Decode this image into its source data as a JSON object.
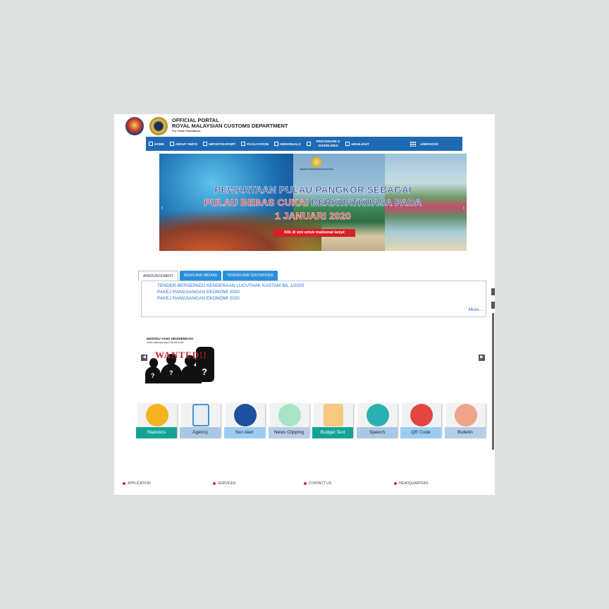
{
  "header": {
    "title_line1": "OFFICIAL PORTAL",
    "title_line2": "ROYAL MALAYSIAN CUSTOMS DEPARTMENT",
    "tagline": "For Trade Facilitation"
  },
  "nav": {
    "items": [
      {
        "label": "HOME",
        "icon": "home-icon"
      },
      {
        "label": "ABOUT RMCD",
        "icon": "person-icon"
      },
      {
        "label": "IMPORT/EXPORT",
        "icon": "list-icon"
      },
      {
        "label": "FACILITATION",
        "icon": "truck-icon"
      },
      {
        "label": "INDIVIDUALS",
        "icon": "car-icon"
      },
      {
        "label_line1": "PROCEDURE &",
        "label_line2": "GUIDELINES",
        "icon": "book-icon"
      },
      {
        "label": "HIGHLIGHT",
        "icon": "highlight-icon"
      }
    ],
    "eservices": "eSERVICES"
  },
  "banner": {
    "logo_text": "JABATAN KASTAM DIRAJA MALAYSIA",
    "line1": "PEWARTAAN PULAU PANGKOR SEBAGAI",
    "line2a": "PULAU BEBAS CUKAI",
    "line2b": " BERKUATKUASA PADA",
    "line3": "1 JANUARI 2020",
    "button": "Klik di sini untuk maklumat lanjut",
    "prev": "‹",
    "next": "›"
  },
  "tabs": [
    "ANNOUNCEMENT",
    "NEWS AND MEDIAS",
    "TENDER AND QUOTATIONS"
  ],
  "announcements": [
    "TENDER BERSEPADU KENDERAAN LUCUTHAK KASTAM BIL 1/2020",
    "PAKEJ RANGSANGAN EKONOMI 2020",
    "PAKEJ RANGSANGAN EKONOMI 2020"
  ],
  "more": "More...",
  "wanted": {
    "title": "INDIVIDU YANG DIKEHENDAKI",
    "subtitle": "Untuk maklumat lanjut, sila klik di sini.",
    "word": "WANTED!!",
    "q": "?",
    "prev": "◀",
    "next": "▶"
  },
  "quicklinks": [
    {
      "label": "Statistics",
      "icon": "statistics-icon",
      "label_bg": "#14a396",
      "circle": "#f4b223",
      "label_color": "#ffffff"
    },
    {
      "label": "Agency",
      "icon": "building-icon",
      "label_bg": "#a9c8e6",
      "circle": "#e9eef2",
      "label_color": "#222222"
    },
    {
      "label": "Nur Alert",
      "icon": "alert-icon",
      "label_bg": "#9bcdf2",
      "circle": "#1d4f9c",
      "label_color": "#222222"
    },
    {
      "label": "News Clipping",
      "icon": "news-icon",
      "label_bg": "#b5cde8",
      "circle": "#a8e3c6",
      "label_color": "#222222"
    },
    {
      "label": "Budget Text",
      "icon": "budget-icon",
      "label_bg": "#14a396",
      "circle": "#f6c980",
      "label_color": "#ffffff"
    },
    {
      "label": "Speech",
      "icon": "speech-icon",
      "label_bg": "#a9c8e6",
      "circle": "#2bb0b2",
      "label_color": "#222222"
    },
    {
      "label": "QR Code",
      "icon": "qr-code-icon",
      "label_bg": "#9bcdf2",
      "circle": "#e4453e",
      "label_color": "#222222"
    },
    {
      "label": "Bulletin",
      "icon": "bulletin-icon",
      "label_bg": "#b5cde8",
      "circle": "#f0a48c",
      "label_color": "#222222"
    }
  ],
  "footer": [
    "APPLICATION",
    "SERVICES",
    "CONTACT US",
    "HEADQUARTERS"
  ],
  "colors": {
    "nav": "#1f6ab3",
    "link": "#2a6fd6",
    "accent_red": "#d81f26"
  }
}
